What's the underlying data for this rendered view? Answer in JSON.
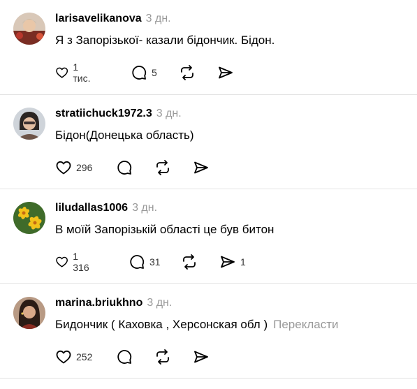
{
  "posts": [
    {
      "username": "larisavelikanova",
      "time": "3 дн.",
      "text": "Я з Запорізької- казали бідончик. Бідон.",
      "likes": "1 тис.",
      "replies": "5",
      "reposts": "",
      "shares": "",
      "translate": ""
    },
    {
      "username": "stratiichuck1972.3",
      "time": "3 дн.",
      "text": "Бідон(Донецька область)",
      "likes": "296",
      "replies": "",
      "reposts": "",
      "shares": "",
      "translate": ""
    },
    {
      "username": "liludallas1006",
      "time": "3 дн.",
      "text": "В моїй Запорізькій області це був битон",
      "likes": "1 316",
      "replies": "31",
      "reposts": "",
      "shares": "1",
      "translate": ""
    },
    {
      "username": "marina.briukhno",
      "time": "3 дн.",
      "text": "Бидончик ( Каховка , Херсонская обл )",
      "likes": "252",
      "replies": "",
      "reposts": "",
      "shares": "",
      "translate": "Перекласти"
    }
  ],
  "icons": {
    "like": "heart-icon",
    "reply": "comment-icon",
    "repost": "repost-icon",
    "share": "send-icon"
  },
  "colors": {
    "text": "#000000",
    "muted": "#999999",
    "divider": "#e3e3e3"
  }
}
